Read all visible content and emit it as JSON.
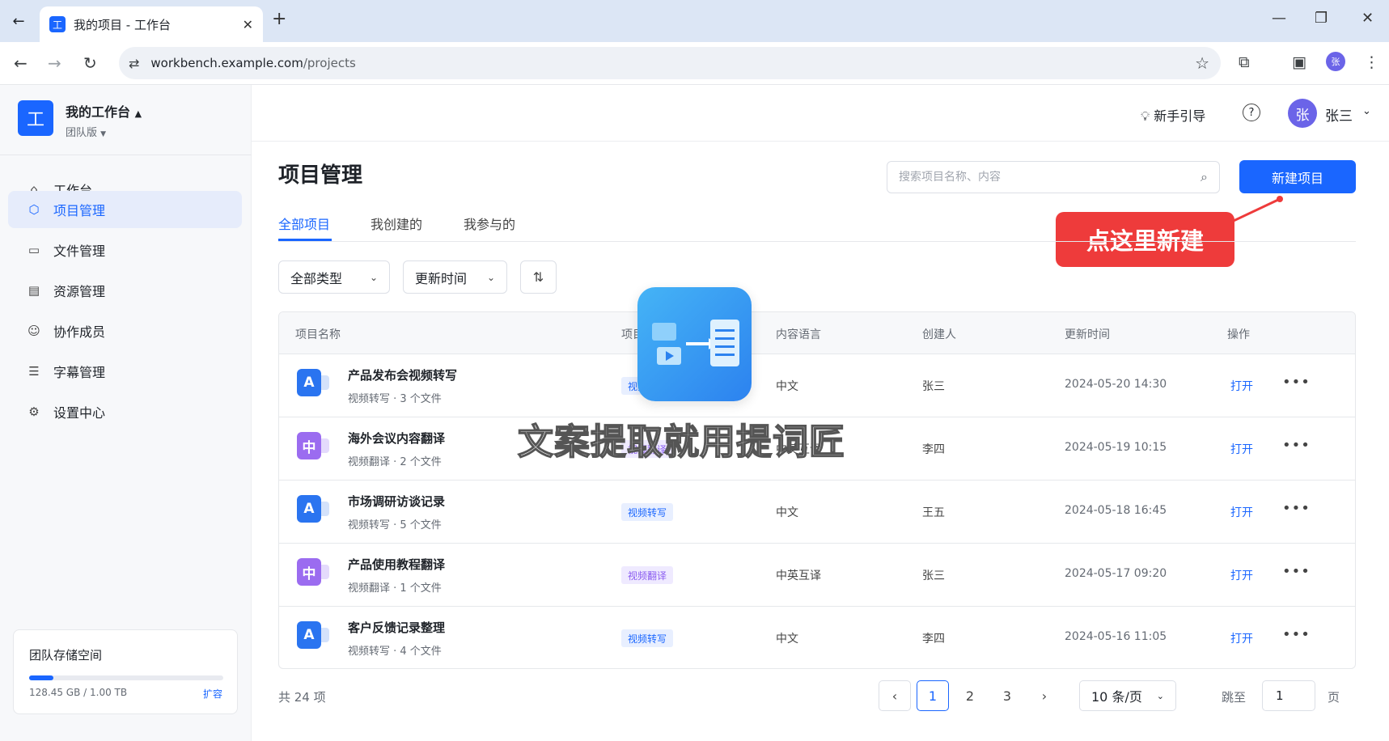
{
  "browser": {
    "tab_title": "我的项目 - 工作台",
    "tab_favicon": "工",
    "url_host": "workbench.example.com",
    "url_path": "/projects",
    "profile_initial": "张"
  },
  "workspace": {
    "logo": "工",
    "name": "我的工作台",
    "edition": "团队版"
  },
  "sidebar": {
    "items": [
      {
        "label": "工作台",
        "icon": "home-icon"
      },
      {
        "label": "项目管理",
        "icon": "cube-icon",
        "active": true
      },
      {
        "label": "文件管理",
        "icon": "folder-icon"
      },
      {
        "label": "资源管理",
        "icon": "resource-icon"
      },
      {
        "label": "协作成员",
        "icon": "members-icon"
      },
      {
        "label": "字幕管理",
        "icon": "subtitle-icon"
      },
      {
        "label": "设置中心",
        "icon": "gear-icon"
      }
    ],
    "storage": {
      "title": "团队存储空间",
      "usage": "128.45 GB / 1.00 TB",
      "used_fraction": 0.125,
      "expand_label": "扩容"
    }
  },
  "header": {
    "guide_label": "新手引导",
    "user_initial": "张",
    "user_name": "张三"
  },
  "page": {
    "title": "项目管理",
    "search_placeholder": "搜索项目名称、内容",
    "new_button": "新建项目",
    "callout": "点这里新建",
    "tabs": [
      "全部项目",
      "我创建的",
      "我参与的"
    ],
    "filters": {
      "type": "全部类型",
      "sort": "更新时间"
    }
  },
  "table": {
    "headers": [
      "项目名称",
      "项目类型",
      "内容语言",
      "创建人",
      "更新时间",
      "操作"
    ],
    "rows": [
      {
        "icon": "A",
        "name": "产品发布会视频转写",
        "meta": "视频转写 · 3 个文件",
        "type": "视频转写",
        "lang": "中文",
        "owner": "张三",
        "time": "2024-05-20 14:30",
        "action": "打开"
      },
      {
        "icon": "中",
        "name": "海外会议内容翻译",
        "meta": "视频翻译 · 2 个文件",
        "type": "视频翻译",
        "lang": "中英互译",
        "owner": "李四",
        "time": "2024-05-19 10:15",
        "action": "打开"
      },
      {
        "icon": "A",
        "name": "市场调研访谈记录",
        "meta": "视频转写 · 5 个文件",
        "type": "视频转写",
        "lang": "中文",
        "owner": "王五",
        "time": "2024-05-18 16:45",
        "action": "打开"
      },
      {
        "icon": "中",
        "name": "产品使用教程翻译",
        "meta": "视频翻译 · 1 个文件",
        "type": "视频翻译",
        "lang": "中英互译",
        "owner": "张三",
        "time": "2024-05-17 09:20",
        "action": "打开"
      },
      {
        "icon": "A",
        "name": "客户反馈记录整理",
        "meta": "视频转写 · 4 个文件",
        "type": "视频转写",
        "lang": "中文",
        "owner": "李四",
        "time": "2024-05-16 11:05",
        "action": "打开"
      }
    ]
  },
  "pagination": {
    "total": "共 24 项",
    "pages": [
      "1",
      "2",
      "3"
    ],
    "current": "1",
    "page_size": "10 条/页",
    "jump_label": "跳至",
    "jump_value": "1",
    "jump_suffix": "页"
  },
  "watermark": {
    "text": "文案提取就用提词匠"
  },
  "colors": {
    "accent": "#1a66ff",
    "callout": "#ee3b3b",
    "translate": "#9b6cf0"
  }
}
